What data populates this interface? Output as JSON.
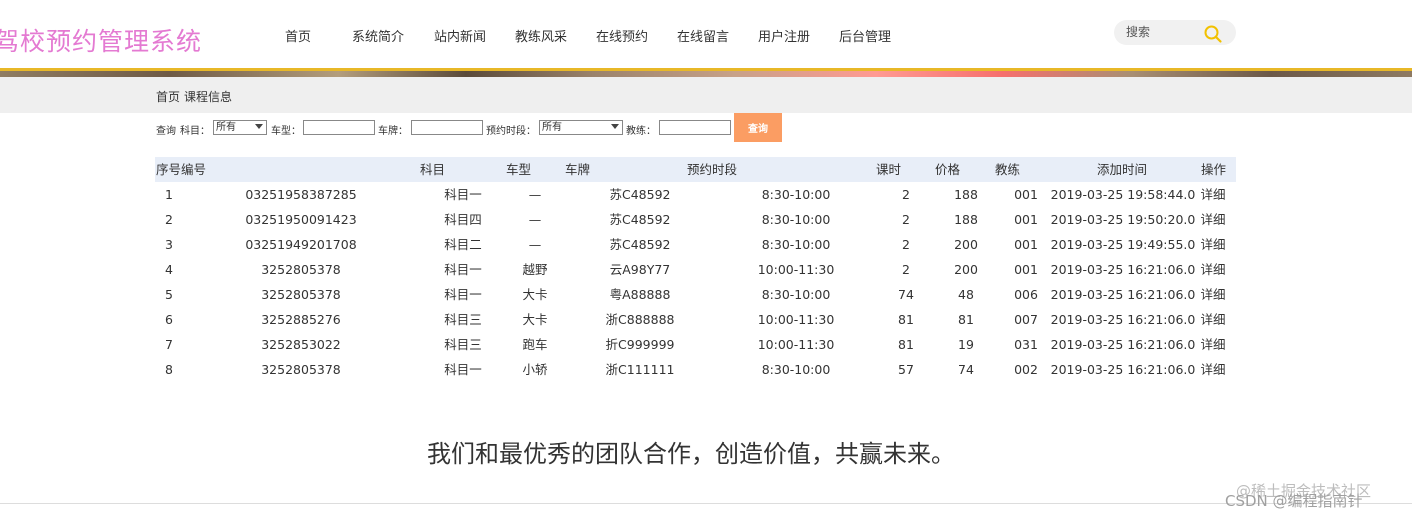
{
  "header": {
    "logo": "驾校预约管理系统",
    "nav": [
      "首页",
      "系统简介",
      "站内新闻",
      "教练风采",
      "在线预约",
      "在线留言",
      "用户注册",
      "后台管理"
    ],
    "search_placeholder": "搜索"
  },
  "breadcrumb": {
    "home": "首页",
    "current": "课程信息"
  },
  "filters": {
    "query_label": "查询",
    "subject_label": "科目：",
    "subject_value": "所有",
    "car_type_label": "车型：",
    "car_type_value": "",
    "plate_label": "车牌：",
    "plate_value": "",
    "slot_label": "预约时段：",
    "slot_value": "所有",
    "coach_label": "教练：",
    "coach_value": "",
    "button": "查询"
  },
  "table": {
    "headers": [
      "序号编号",
      "科目",
      "车型",
      "车牌",
      "预约时段",
      "课时",
      "价格",
      "教练",
      "添加时间",
      "操作"
    ],
    "rows": [
      {
        "idx": "1",
        "code": "03251958387285",
        "subject": "科目一",
        "car_type": "—",
        "plate": "苏C48592",
        "slot": "8:30-10:00",
        "hours": "2",
        "price": "188",
        "coach": "001",
        "added": "2019-03-25 19:58:44.0",
        "op": "详细"
      },
      {
        "idx": "2",
        "code": "03251950091423",
        "subject": "科目四",
        "car_type": "—",
        "plate": "苏C48592",
        "slot": "8:30-10:00",
        "hours": "2",
        "price": "188",
        "coach": "001",
        "added": "2019-03-25 19:50:20.0",
        "op": "详细"
      },
      {
        "idx": "3",
        "code": "03251949201708",
        "subject": "科目二",
        "car_type": "—",
        "plate": "苏C48592",
        "slot": "8:30-10:00",
        "hours": "2",
        "price": "200",
        "coach": "001",
        "added": "2019-03-25 19:49:55.0",
        "op": "详细"
      },
      {
        "idx": "4",
        "code": "3252805378",
        "subject": "科目一",
        "car_type": "越野",
        "plate": "云A98Y77",
        "slot": "10:00-11:30",
        "hours": "2",
        "price": "200",
        "coach": "001",
        "added": "2019-03-25 16:21:06.0",
        "op": "详细"
      },
      {
        "idx": "5",
        "code": "3252805378",
        "subject": "科目一",
        "car_type": "大卡",
        "plate": "粤A88888",
        "slot": "8:30-10:00",
        "hours": "74",
        "price": "48",
        "coach": "006",
        "added": "2019-03-25 16:21:06.0",
        "op": "详细"
      },
      {
        "idx": "6",
        "code": "3252885276",
        "subject": "科目三",
        "car_type": "大卡",
        "plate": "浙C888888",
        "slot": "10:00-11:30",
        "hours": "81",
        "price": "81",
        "coach": "007",
        "added": "2019-03-25 16:21:06.0",
        "op": "详细"
      },
      {
        "idx": "7",
        "code": "3252853022",
        "subject": "科目三",
        "car_type": "跑车",
        "plate": "折C999999",
        "slot": "10:00-11:30",
        "hours": "81",
        "price": "19",
        "coach": "031",
        "added": "2019-03-25 16:21:06.0",
        "op": "详细"
      },
      {
        "idx": "8",
        "code": "3252805378",
        "subject": "科目一",
        "car_type": "小轿",
        "plate": "浙C111111",
        "slot": "8:30-10:00",
        "hours": "57",
        "price": "74",
        "coach": "002",
        "added": "2019-03-25 16:21:06.0",
        "op": "详细"
      }
    ]
  },
  "footer": {
    "slogan": "我们和最优秀的团队合作，创造价值，共赢未来。",
    "watermark_1": "@稀土掘金技术社区",
    "watermark_2": "CSDN @编程指南针"
  },
  "colors": {
    "logo": "#e47ad2",
    "query_button": "#fb9d63",
    "table_header_bg": "#e8eef8",
    "crumb_bg": "#efefef"
  }
}
